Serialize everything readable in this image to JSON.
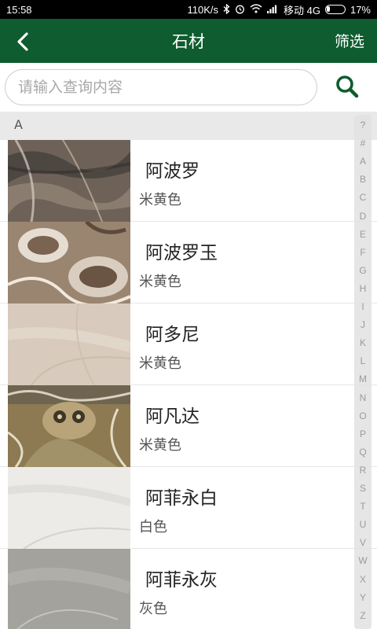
{
  "status_bar": {
    "time": "15:58",
    "network_speed": "110K/s",
    "carrier": "移动 4G",
    "battery": "17%",
    "battery_level": 0.17,
    "icons": [
      "bluetooth-icon",
      "alarm-icon",
      "wifi-icon",
      "signal-icon",
      "battery-icon"
    ]
  },
  "header": {
    "title": "石材",
    "filter_label": "筛选",
    "back_icon": "chevron-left-icon"
  },
  "search": {
    "placeholder": "请输入查询内容",
    "value": "",
    "icon": "search-icon"
  },
  "section_header": "A",
  "items": [
    {
      "name": "阿波罗",
      "color": "米黄色",
      "thumb": "marble-apollo"
    },
    {
      "name": "阿波罗玉",
      "color": "米黄色",
      "thumb": "onyx-apollo-jade"
    },
    {
      "name": "阿多尼",
      "color": "米黄色",
      "thumb": "marble-adoni"
    },
    {
      "name": "阿凡达",
      "color": "米黄色",
      "thumb": "marble-avatar"
    },
    {
      "name": "阿菲永白",
      "color": "白色",
      "thumb": "marble-afyon-white"
    },
    {
      "name": "阿菲永灰",
      "color": "灰色",
      "thumb": "marble-afyon-grey"
    }
  ],
  "index_letters": [
    "?",
    "#",
    "A",
    "B",
    "C",
    "D",
    "E",
    "F",
    "G",
    "H",
    "I",
    "J",
    "K",
    "L",
    "M",
    "N",
    "O",
    "P",
    "Q",
    "R",
    "S",
    "T",
    "U",
    "V",
    "W",
    "X",
    "Y",
    "Z"
  ],
  "colors": {
    "header_bg": "#0e5c2f",
    "search_icon": "#0e5c2f",
    "section_bg": "#e9e9e9"
  }
}
